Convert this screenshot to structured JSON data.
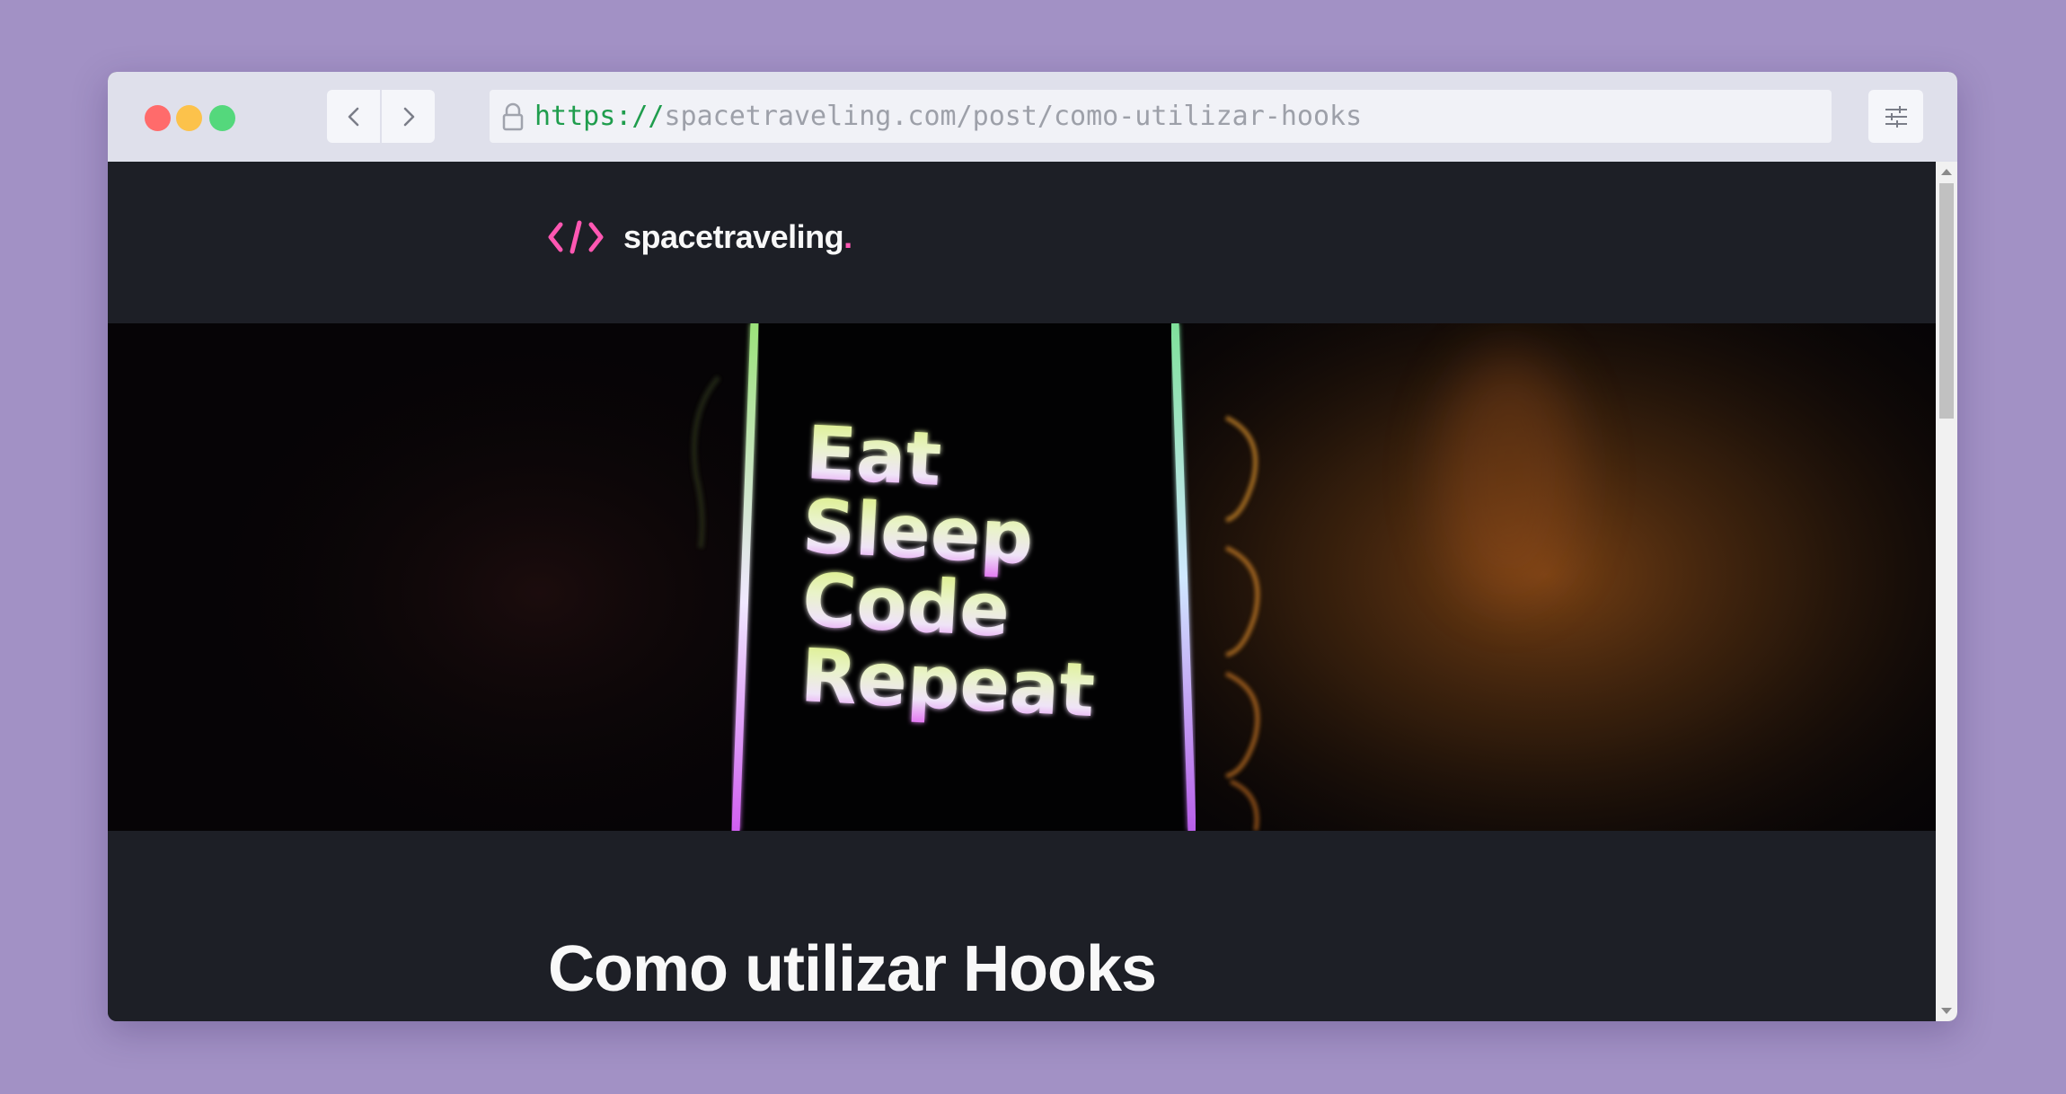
{
  "browser": {
    "url_protocol": "https://",
    "url_rest": "spacetraveling.com/post/como-utilizar-hooks",
    "icons": {
      "back": "chevron-left-icon",
      "forward": "chevron-right-icon",
      "lock": "lock-icon",
      "settings": "sliders-icon"
    }
  },
  "site": {
    "logo_text": "spacetraveling",
    "logo_dot": ".",
    "logo_icon": "code-brackets-icon",
    "accent_color": "#ff57b2",
    "background_color": "#1d1f26"
  },
  "banner": {
    "lines": [
      "Eat",
      "Sleep",
      "Code",
      "Repeat"
    ]
  },
  "post": {
    "title": "Como utilizar Hooks"
  }
}
